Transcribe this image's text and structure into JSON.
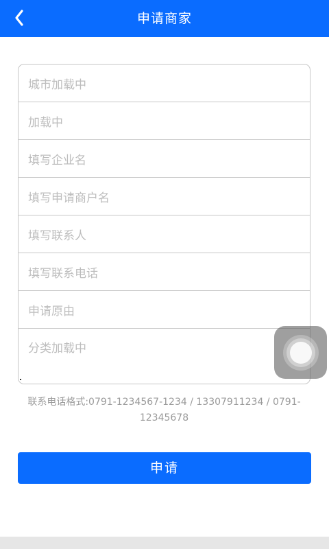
{
  "header": {
    "title": "申请商家",
    "back_icon": "chevron-left-icon",
    "background": "#0a6cff"
  },
  "form": {
    "fields": [
      {
        "placeholder": "城市加载中"
      },
      {
        "placeholder": "加载中"
      },
      {
        "placeholder": "填写企业名"
      },
      {
        "placeholder": "填写申请商户名"
      },
      {
        "placeholder": "填写联系人"
      },
      {
        "placeholder": "填写联系电话"
      },
      {
        "placeholder": "申请原由"
      },
      {
        "placeholder": "分类加载中"
      }
    ]
  },
  "hint": "联系电话格式:0791-1234567-1234 / 13307911234 / 0791-12345678",
  "submit": {
    "label": "申请",
    "background": "#0a6cff"
  },
  "assistive_touch": {
    "icon": "assistive-touch-icon"
  }
}
